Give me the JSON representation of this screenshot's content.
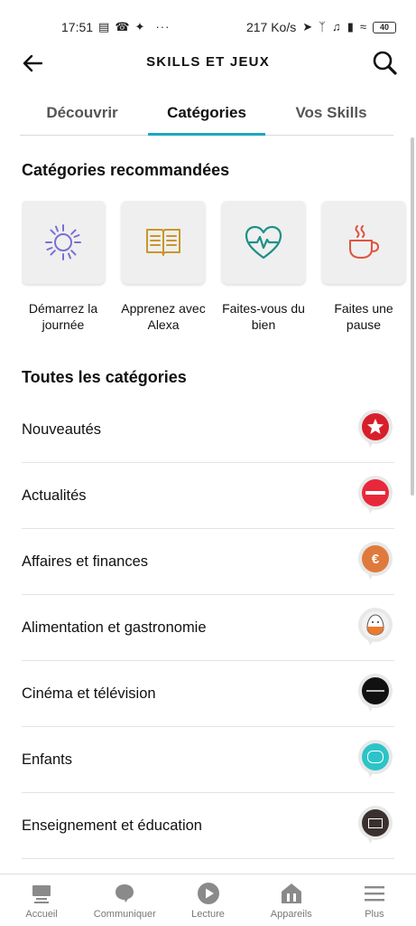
{
  "status_bar": {
    "time": "17:51",
    "speed": "217 Ko/s",
    "battery": "40"
  },
  "header": {
    "title": "SKILLS ET JEUX"
  },
  "tabs": [
    {
      "label": "Découvrir"
    },
    {
      "label": "Catégories"
    },
    {
      "label": "Vos Skills"
    }
  ],
  "recommended": {
    "title": "Catégories recommandées",
    "items": [
      {
        "label": "Démarrez la journée",
        "icon": "sun-icon",
        "color": "#7b6fd3"
      },
      {
        "label": "Apprenez avec Alexa",
        "icon": "book-icon",
        "color": "#c9962a"
      },
      {
        "label": "Faites-vous du bien",
        "icon": "heart-pulse-icon",
        "color": "#1f8f86"
      },
      {
        "label": "Faites une pause",
        "icon": "coffee-cup-icon",
        "color": "#e0533f"
      }
    ]
  },
  "all_categories": {
    "title": "Toutes les catégories",
    "items": [
      {
        "label": "Nouveautés",
        "color": "#d71f2b"
      },
      {
        "label": "Actualités",
        "color": "#e8283a"
      },
      {
        "label": "Affaires et finances",
        "color": "#e07a3c"
      },
      {
        "label": "Alimentation et gastronomie",
        "color": "#f2f2f2"
      },
      {
        "label": "Cinéma et télévision",
        "color": "#111111"
      },
      {
        "label": "Enfants",
        "color": "#2cc4c8"
      },
      {
        "label": "Enseignement et éducation",
        "color": "#3a3030"
      }
    ]
  },
  "bottom_nav": [
    {
      "label": "Accueil",
      "icon": "home-icon"
    },
    {
      "label": "Communiquer",
      "icon": "chat-bubble-icon"
    },
    {
      "label": "Lecture",
      "icon": "play-icon"
    },
    {
      "label": "Appareils",
      "icon": "devices-icon"
    },
    {
      "label": "Plus",
      "icon": "menu-icon"
    }
  ]
}
